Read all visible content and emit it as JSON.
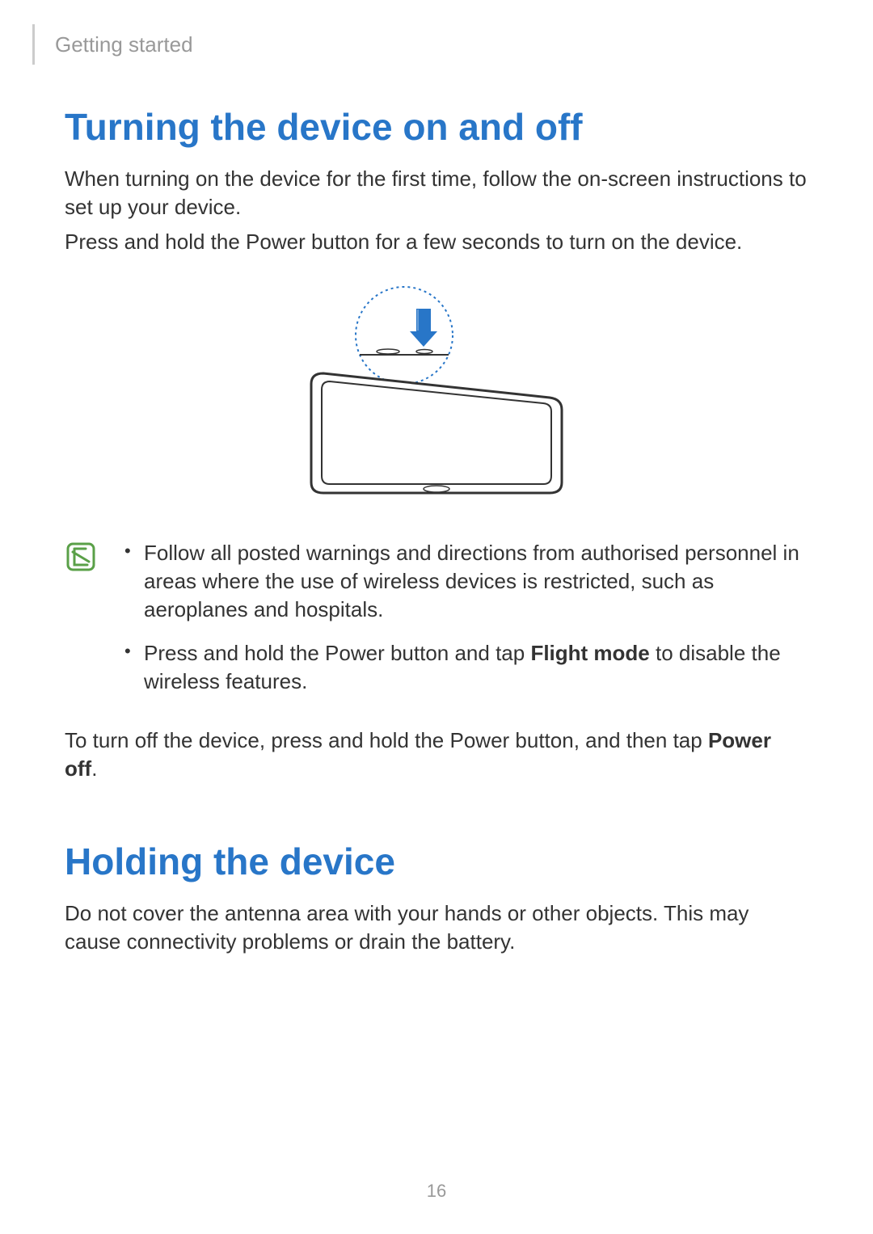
{
  "header": {
    "section_name": "Getting started"
  },
  "section1": {
    "heading": "Turning the device on and off",
    "para1": "When turning on the device for the first time, follow the on-screen instructions to set up your device.",
    "para2": "Press and hold the Power button for a few seconds to turn on the device.",
    "note_items": {
      "item1": "Follow all posted warnings and directions from authorised personnel in areas where the use of wireless devices is restricted, such as aeroplanes and hospitals.",
      "item2_pre": "Press and hold the Power button and tap ",
      "item2_bold": "Flight mode",
      "item2_post": " to disable the wireless features."
    },
    "para3_pre": "To turn off the device, press and hold the Power button, and then tap ",
    "para3_bold": "Power off",
    "para3_post": "."
  },
  "section2": {
    "heading": "Holding the device",
    "para1": "Do not cover the antenna area with your hands or other objects. This may cause connectivity problems or drain the battery."
  },
  "page_number": "16",
  "colors": {
    "heading": "#2876c8",
    "muted": "#999999",
    "arrow": "#2876c8",
    "note_icon_stroke": "#5aa048"
  }
}
